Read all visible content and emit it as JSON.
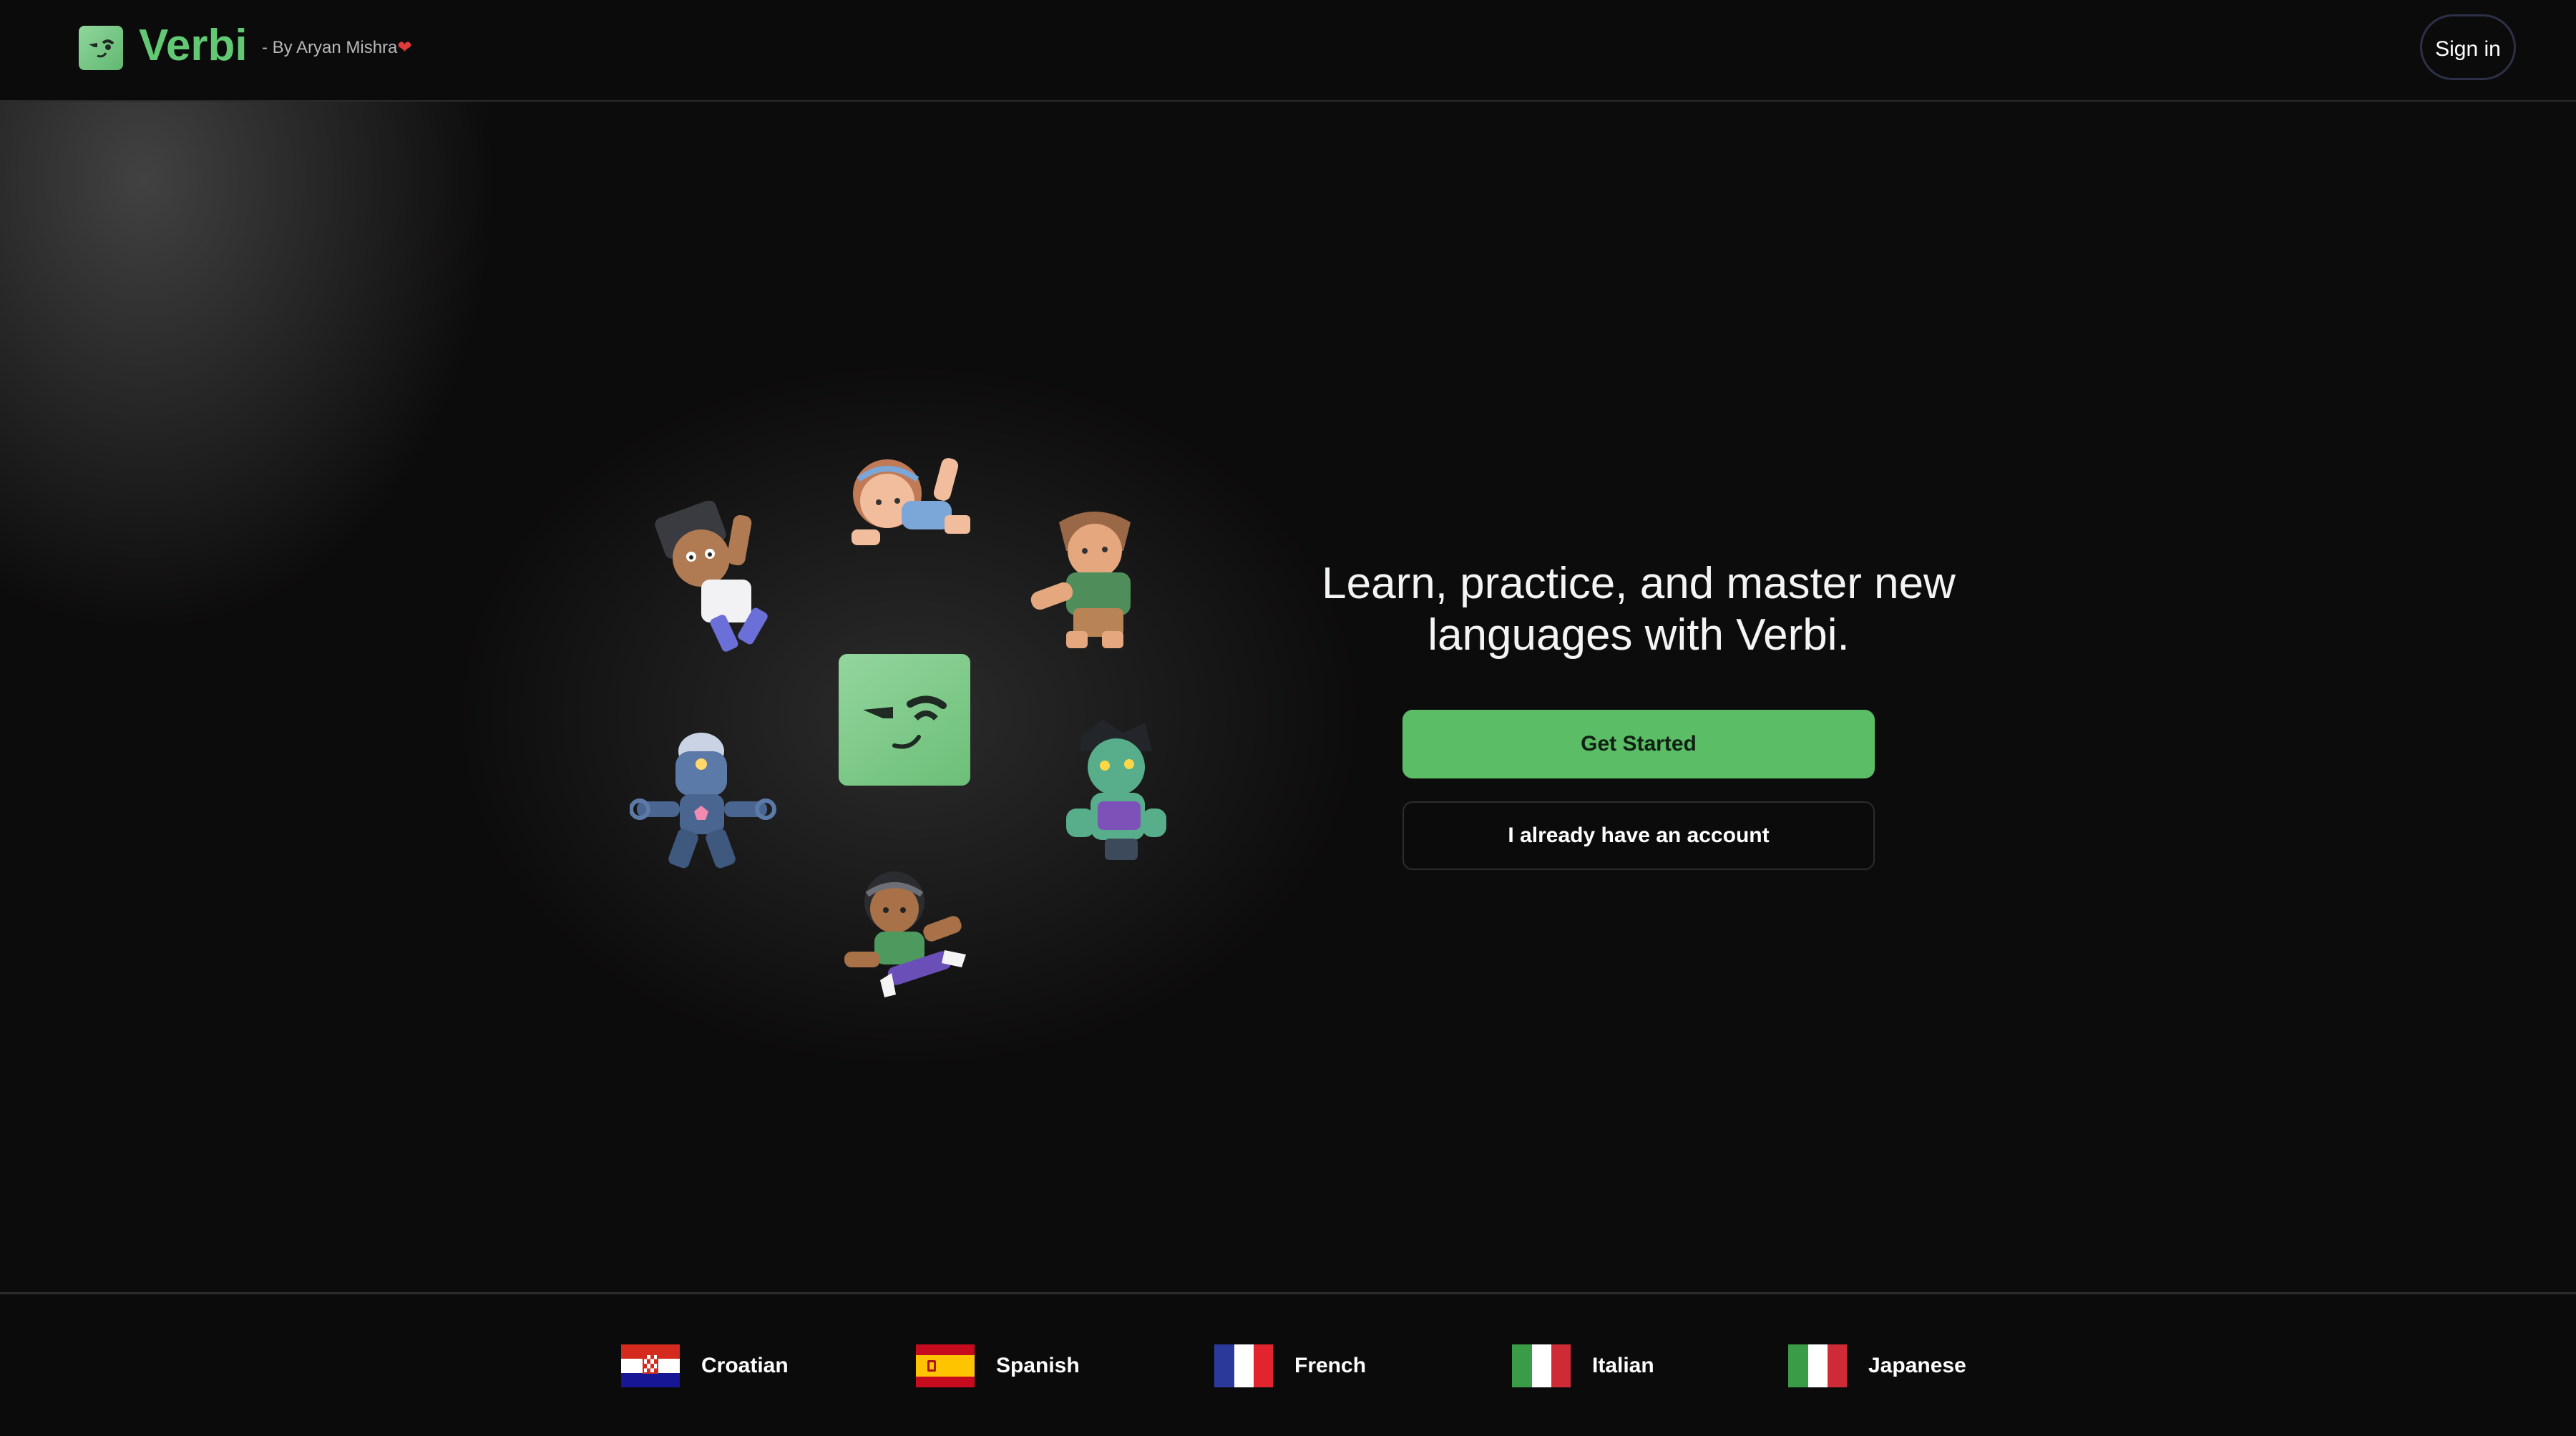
{
  "header": {
    "brand": "Verbi",
    "byline": "- By Aryan Mishra",
    "byline_heart": "❤",
    "signin_label": "Sign in"
  },
  "hero": {
    "title_line1": "Learn, practice, and master new",
    "title_line2": "languages with Verbi.",
    "primary_label": "Get Started",
    "secondary_label": "I already have an account"
  },
  "languages": [
    {
      "label": "Croatian",
      "flag": "croatia-flag"
    },
    {
      "label": "Spanish",
      "flag": "spain-flag"
    },
    {
      "label": "French",
      "flag": "france-flag"
    },
    {
      "label": "Italian",
      "flag": "italy-flag"
    },
    {
      "label": "Japanese",
      "flag": "italy-flag"
    }
  ],
  "colors": {
    "brand": "#63c874",
    "primary_button": "#5bbd66",
    "background": "#0d0c0c"
  }
}
